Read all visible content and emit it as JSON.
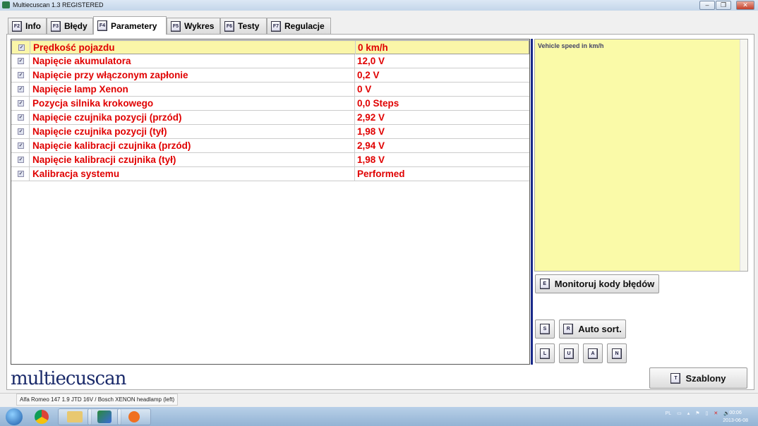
{
  "window": {
    "title": "Multiecuscan 1.3 REGISTERED",
    "minimize": "–",
    "maximize": "❐",
    "close": "✕"
  },
  "tabs": [
    {
      "key": "F2",
      "label": "Info"
    },
    {
      "key": "F3",
      "label": "Błędy"
    },
    {
      "key": "F4",
      "label": "Parametery",
      "active": true
    },
    {
      "key": "F5",
      "label": "Wykres"
    },
    {
      "key": "F6",
      "label": "Testy"
    },
    {
      "key": "F7",
      "label": "Regulacje"
    }
  ],
  "parameters": [
    {
      "name": "Prędkość pojazdu",
      "value": "0 km/h",
      "checked": true
    },
    {
      "name": "Napięcie akumulatora",
      "value": "12,0 V",
      "checked": true
    },
    {
      "name": "Napięcie przy włączonym zapłonie",
      "value": "0,2 V",
      "checked": true
    },
    {
      "name": "Napięcie lamp Xenon",
      "value": "0 V",
      "checked": true
    },
    {
      "name": "Pozycja silnika krokowego",
      "value": "0,0 Steps",
      "checked": true
    },
    {
      "name": "Napięcie czujnika pozycji (przód)",
      "value": "2,92 V",
      "checked": true
    },
    {
      "name": "Napięcie czujnika pozycji (tył)",
      "value": "1,98 V",
      "checked": true
    },
    {
      "name": "Napięcie kalibracji czujnika (przód)",
      "value": "2,94 V",
      "checked": true
    },
    {
      "name": "Napięcie kalibracji czujnika (tył)",
      "value": "1,98 V",
      "checked": true
    },
    {
      "name": "Kalibracja systemu",
      "value": "Performed",
      "checked": true
    }
  ],
  "description": "Vehicle speed in km/h",
  "buttons": {
    "monitor": {
      "key": "E",
      "label": "Monitoruj kody błędów"
    },
    "s": {
      "key": "S"
    },
    "autosort": {
      "key": "R",
      "label": "Auto sort."
    },
    "l": {
      "key": "L"
    },
    "u": {
      "key": "U"
    },
    "a": {
      "key": "A"
    },
    "n": {
      "key": "N"
    },
    "templates": {
      "key": "T",
      "label": "Szablony"
    }
  },
  "logo": "multiecuscan",
  "status": "Alfa Romeo 147 1.9 JTD 16V / Bosch XENON headlamp (left)",
  "taskbar": {
    "lang": "PL",
    "time": "00:06",
    "date": "2013-06-08"
  }
}
